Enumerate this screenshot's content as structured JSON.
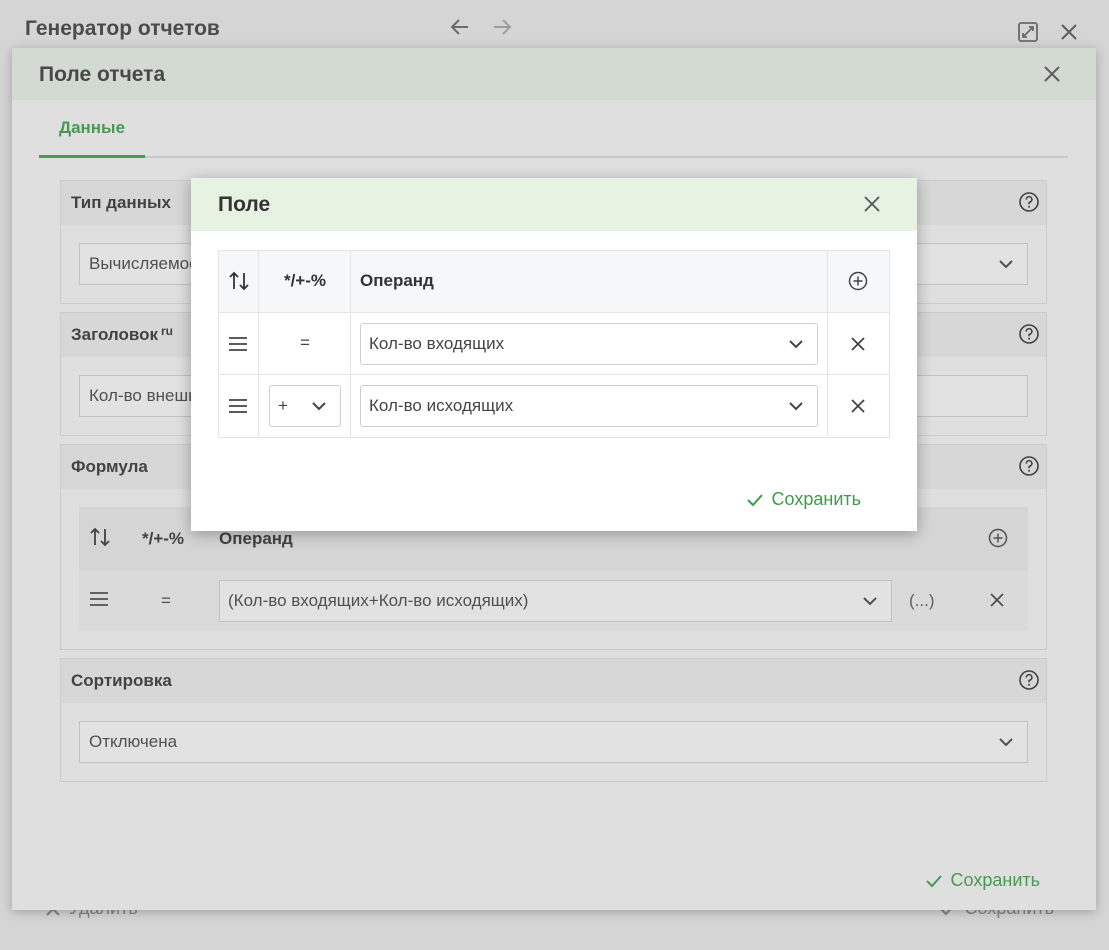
{
  "window": {
    "title": "Генератор отчетов",
    "footer": {
      "delete_label": "Удалить",
      "save_label": "Сохранить"
    }
  },
  "report_field": {
    "title": "Поле отчета",
    "tab_data": "Данные",
    "data_type": {
      "label": "Тип данных",
      "value": "Вычисляемое"
    },
    "caption": {
      "label": "Заголовок",
      "lang": "ru",
      "value": "Кол-во внешних"
    },
    "formula": {
      "label": "Формула",
      "col_ops": "*/+-%",
      "col_operand": "Операнд",
      "row": {
        "op": "=",
        "value": "(Кол-во входящих+Кол-во исходящих)",
        "more": "(...)"
      }
    },
    "sorting": {
      "label": "Сортировка",
      "value": "Отключена"
    },
    "save_label": "Сохранить"
  },
  "field_modal": {
    "title": "Поле",
    "col_ops": "*/+-%",
    "col_operand": "Операнд",
    "rows": [
      {
        "op": "=",
        "operand": "Кол-во входящих"
      },
      {
        "op": "+",
        "operand": "Кол-во исходящих"
      }
    ],
    "save_label": "Сохранить"
  },
  "colors": {
    "accent": "#3e9b48",
    "modal_header": "#e6f3e3"
  }
}
